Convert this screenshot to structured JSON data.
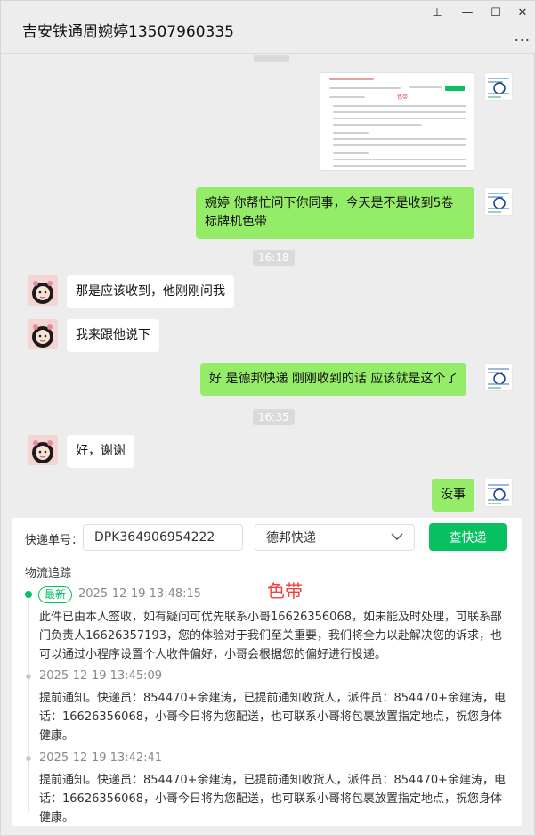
{
  "window": {
    "title": "吉安铁通周婉婷13507960335",
    "controls": {
      "pin": "⊥",
      "minimize": "—",
      "maximize": "☐",
      "close": "✕",
      "more": "..."
    }
  },
  "chat": {
    "messages": [
      {
        "id": "m1",
        "side": "out",
        "type": "image"
      },
      {
        "id": "m2",
        "side": "out",
        "text": "婉婷 你帮忙问下你同事，今天是不是收到5卷标牌机色带"
      },
      {
        "id": "t1",
        "type": "time",
        "text": "16:18"
      },
      {
        "id": "m3",
        "side": "in",
        "text": "那是应该收到，他刚刚问我"
      },
      {
        "id": "m4",
        "side": "in",
        "text": "我来跟他说下"
      },
      {
        "id": "m5",
        "side": "out",
        "text": "好 是德邦快递  刚刚收到的话  应该就是这个了"
      },
      {
        "id": "t2",
        "type": "time",
        "text": "16:35"
      },
      {
        "id": "m6",
        "side": "in",
        "text": "好，谢谢"
      },
      {
        "id": "m7",
        "side": "out",
        "text": "没事"
      }
    ],
    "image_thumb": {
      "red_label": "色带"
    }
  },
  "tracker": {
    "label_no": "快递单号：",
    "tracking_no": "DPK364906954222",
    "carrier": "德邦快递",
    "query_label": "查快递",
    "section_title": "物流追踪",
    "annotation": "色带",
    "events": [
      {
        "badge": "最新",
        "time": "2025-12-19 13:48:15",
        "desc": "此件已由本人签收，如有疑问可优先联系小哥16626356068，如未能及时处理，可联系部门负责人16626357193，您的体验对于我们至关重要，我们将全力以赴解决您的诉求，也可以通过小程序设置个人收件偏好，小哥会根据您的偏好进行投递。"
      },
      {
        "time": "2025-12-19 13:45:09",
        "desc": "提前通知。快递员：854470+余建涛，已提前通知收货人，派件员：854470+余建涛，电话：16626356068，小哥今日将为您配送，也可联系小哥将包裹放置指定地点，祝您身体健康。"
      },
      {
        "time": "2025-12-19 13:42:41",
        "desc": "提前通知。快递员：854470+余建涛，已提前通知收货人，派件员：854470+余建涛，电话：16626356068，小哥今日将为您配送，也可联系小哥将包裹放置指定地点，祝您身体健康。"
      }
    ]
  },
  "colors": {
    "accent": "#07c160",
    "out_bubble": "#95ec69",
    "annotation_red": "#f04040"
  }
}
